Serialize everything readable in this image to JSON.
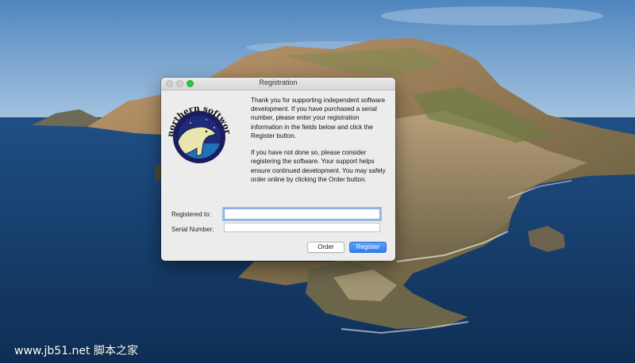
{
  "window": {
    "title": "Registration"
  },
  "logo": {
    "text": "northern softworks",
    "colors": {
      "ring": "#1c1c5e",
      "sky": "#1e2a7a",
      "water": "#1e73b8",
      "bear": "#e8e6b0"
    }
  },
  "info": {
    "paragraph1": "Thank you for supporting independent software development.  If you have purchased a serial number, please enter your registration information in the fields below and click the Register button.",
    "paragraph2": "If you have not done so, please consider registering the software.  Your support helps ensure continued development.  You may safely order online by clicking the Order button."
  },
  "form": {
    "registered_to_label": "Registered to:",
    "registered_to_value": "",
    "serial_number_label": "Serial Number:",
    "serial_number_value": ""
  },
  "buttons": {
    "order_label": "Order",
    "register_label": "Register"
  },
  "watermark": "www.jb51.net 脚本之家",
  "colors": {
    "accent": "#2f7ff0",
    "zoom_button": "#28c840",
    "window_bg": "#ececec"
  }
}
